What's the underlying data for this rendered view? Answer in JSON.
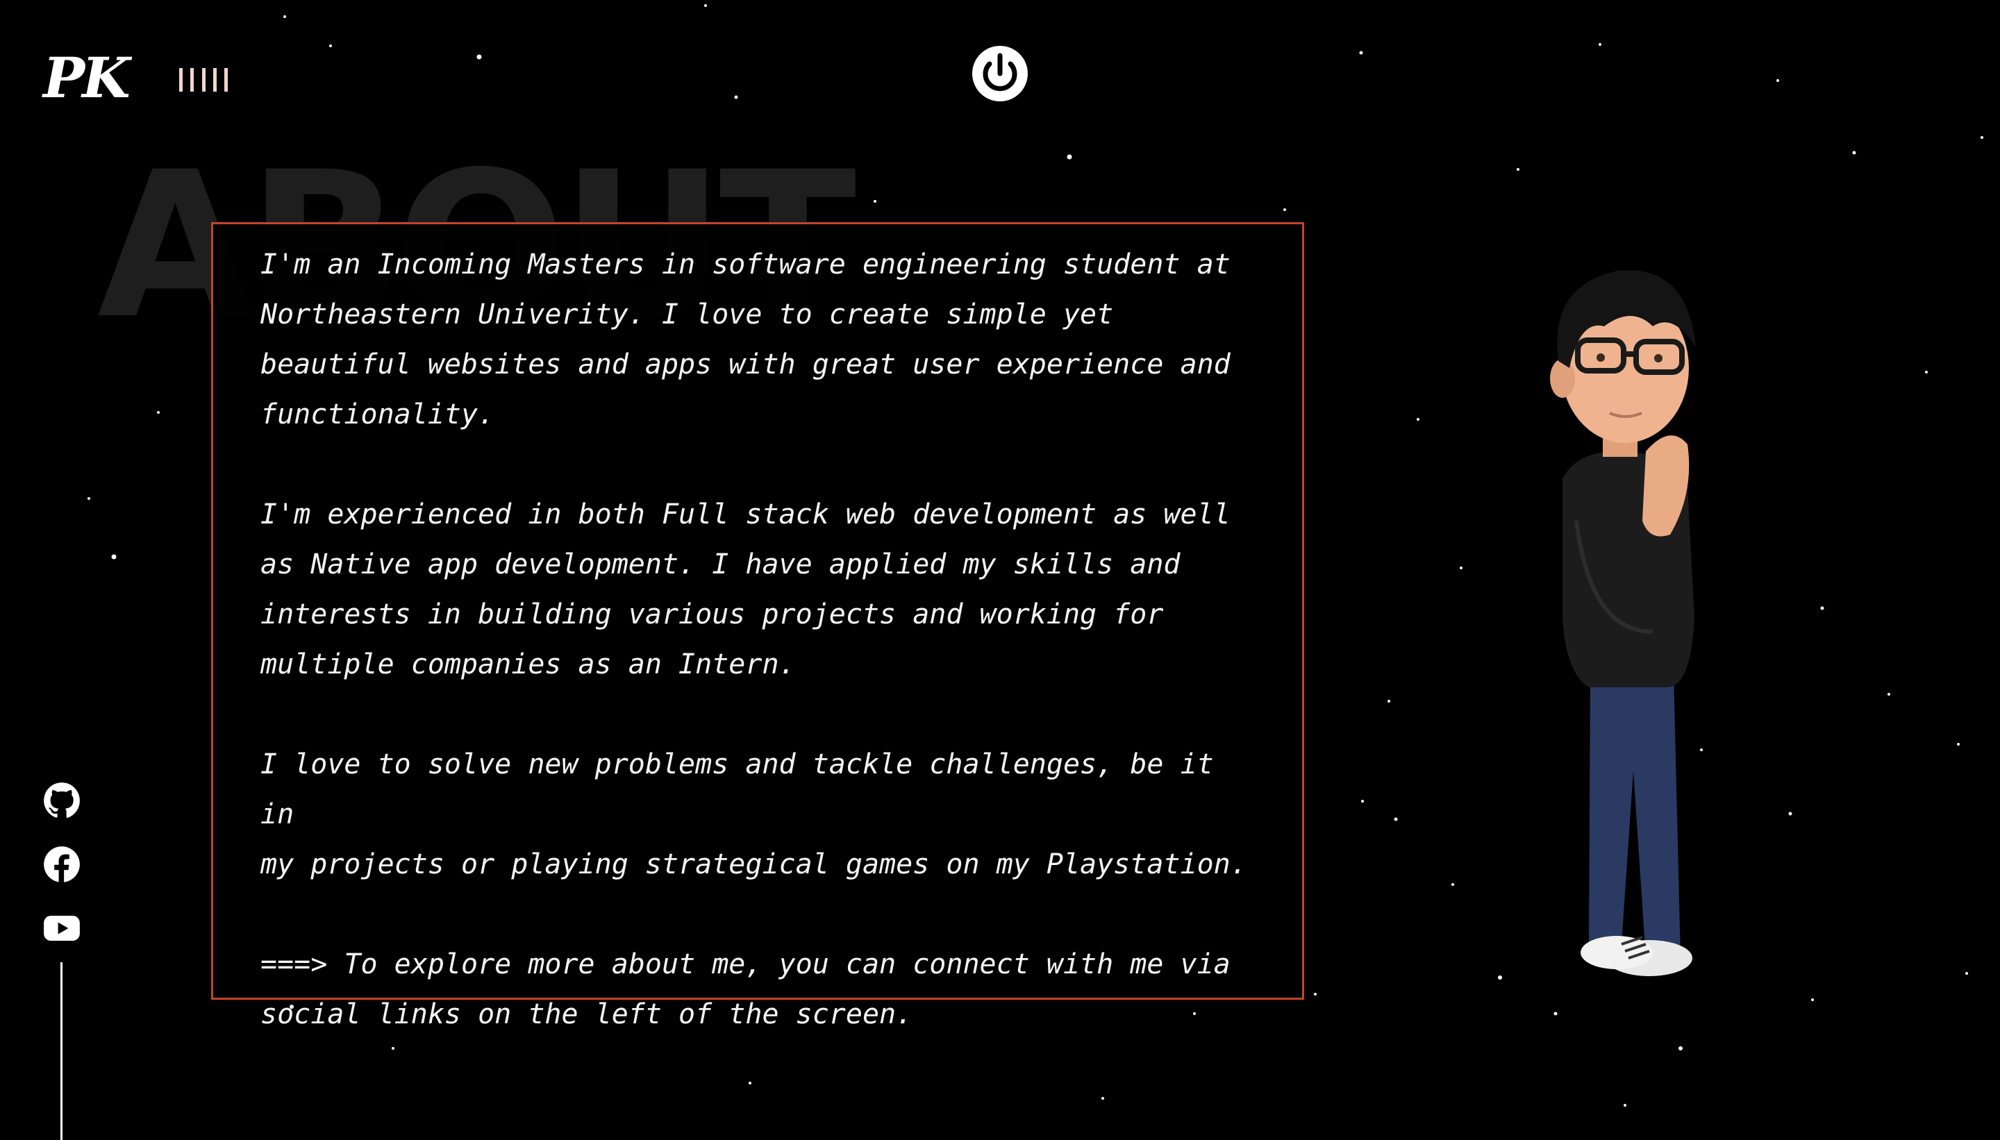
{
  "header": {
    "logo_text": "PK",
    "sound_label": "sound-toggle",
    "power_icon": "power-icon"
  },
  "about": {
    "background_title": "ABOUT",
    "paragraphs": [
      "I'm an Incoming Masters in software engineering student at\nNortheastern Univerity. I love to create simple yet\nbeautiful websites and apps with great user experience and\nfunctionality.",
      "I'm experienced in both Full stack web development as well\nas Native app development. I have applied my skills and\ninterests in building various projects and working for\nmultiple companies as an Intern.",
      "I love to solve new problems and tackle challenges, be it in\nmy projects or playing strategical games on my Playstation.",
      "===> To explore more about me, you can connect with me via\nsocial links on the left of the screen."
    ]
  },
  "socials": [
    {
      "icon": "github-icon"
    },
    {
      "icon": "facebook-icon"
    },
    {
      "icon": "youtube-icon"
    }
  ],
  "colors": {
    "background": "#000000",
    "accent_border": "#c4442c",
    "text": "#f4f4f4",
    "bg_title": "#1e1e1e"
  }
}
